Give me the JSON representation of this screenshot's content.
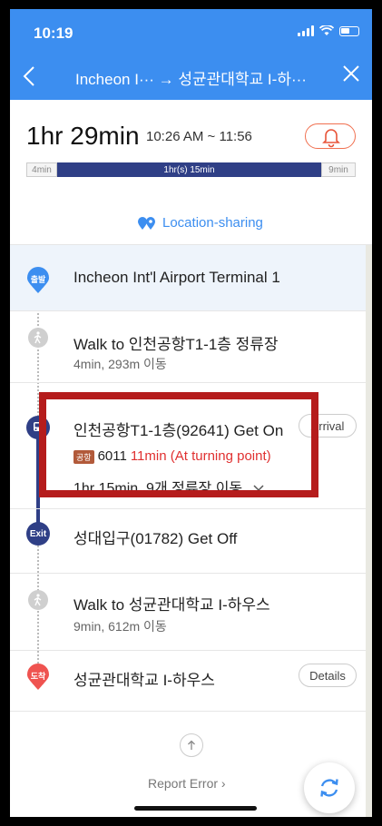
{
  "status": {
    "time": "10:19"
  },
  "header": {
    "title": "Incheon I··· → 성균관대학교 I-하···"
  },
  "summary": {
    "duration": "1hr 29min",
    "time_range": "10:26 AM ~ 11:56",
    "segments": [
      {
        "label": "4min",
        "kind": "walk"
      },
      {
        "label": "1hr(s) 15min",
        "kind": "bus"
      },
      {
        "label": "9min",
        "kind": "walk"
      }
    ],
    "share_label": "Location-sharing"
  },
  "steps": {
    "depart": {
      "badge": "출발",
      "text": "Incheon Int'l Airport Terminal 1"
    },
    "walk1": {
      "text": "Walk to 인천공항T1-1층 정류장",
      "sub": "4min, 293m 이동"
    },
    "board": {
      "text": "인천공항T1-1층(92641) Get On",
      "arrival_label": "Arrival",
      "bus_type": "공항",
      "bus_number": "6011",
      "eta": "11min (At turning point)",
      "sub": "1hr 15min, 9개 정류장 이동"
    },
    "exit": {
      "badge": "Exit",
      "text": "성대입구(01782) Get Off"
    },
    "walk2": {
      "text": "Walk to 성균관대학교 I-하우스",
      "sub": "9min, 612m 이동"
    },
    "arrive": {
      "badge": "도착",
      "text": "성균관대학교 I-하우스",
      "details_label": "Details"
    }
  },
  "footer": {
    "report_label": "Report Error ›"
  },
  "colors": {
    "primary": "#3c8ef0",
    "bus": "#2f3f86",
    "arrive": "#ef5350",
    "highlight": "#b51c1c"
  }
}
